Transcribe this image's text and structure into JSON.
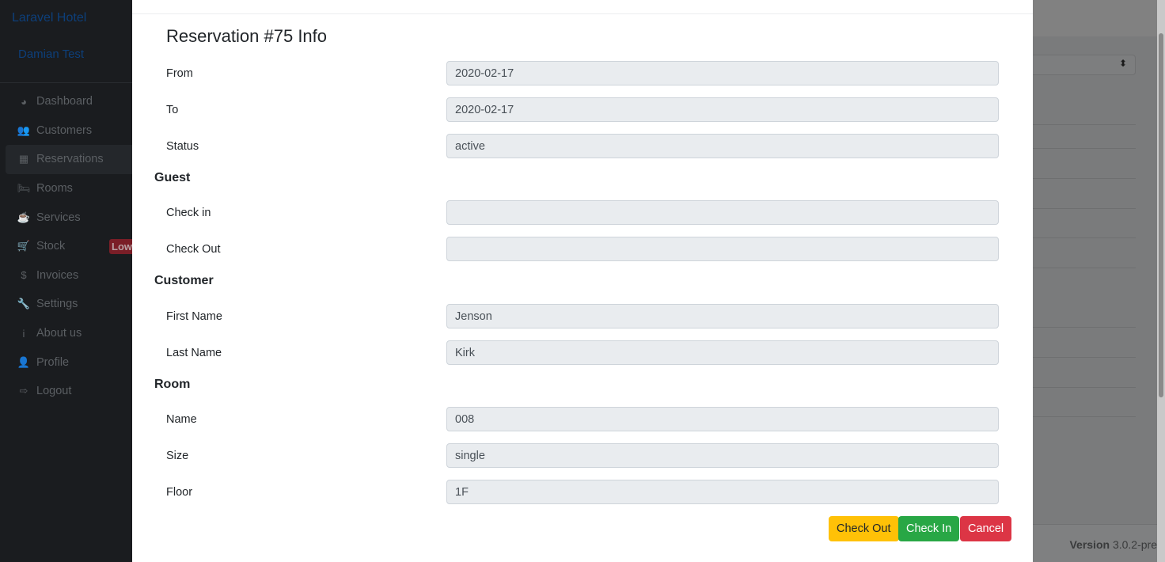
{
  "sidebar": {
    "brand": "Laravel Hotel",
    "user": "Damian Test",
    "items": [
      {
        "label": "Dashboard",
        "icon": "◕"
      },
      {
        "label": "Customers",
        "icon": "👥"
      },
      {
        "label": "Reservations",
        "icon": "▦"
      },
      {
        "label": "Rooms",
        "icon": "🛏"
      },
      {
        "label": "Services",
        "icon": "☕"
      },
      {
        "label": "Stock",
        "icon": "🛒",
        "badge": "Low"
      },
      {
        "label": "Invoices",
        "icon": "$"
      },
      {
        "label": "Settings",
        "icon": "🔧"
      },
      {
        "label": "About us",
        "icon": "i"
      },
      {
        "label": "Profile",
        "icon": "👤"
      },
      {
        "label": "Logout",
        "icon": "⇨"
      }
    ]
  },
  "footer": {
    "version_label": "Version",
    "version": "3.0.2-pre"
  },
  "modal": {
    "title": "Reservation #75 Info",
    "fields": [
      {
        "label": "From",
        "value": "2020-02-17"
      },
      {
        "label": "To",
        "value": "2020-02-17"
      },
      {
        "label": "Status",
        "value": "active"
      }
    ],
    "guest": {
      "heading": "Guest",
      "fields": [
        {
          "label": "Check in",
          "value": ""
        },
        {
          "label": "Check Out",
          "value": ""
        }
      ]
    },
    "customer": {
      "heading": "Customer",
      "fields": [
        {
          "label": "First Name",
          "value": "Jenson"
        },
        {
          "label": "Last Name",
          "value": "Kirk"
        }
      ]
    },
    "room": {
      "heading": "Room",
      "fields": [
        {
          "label": "Name",
          "value": "008"
        },
        {
          "label": "Size",
          "value": "single"
        },
        {
          "label": "Floor",
          "value": "1F"
        }
      ]
    },
    "buttons": {
      "check_out": "Check Out",
      "check_in": "Check In",
      "cancel": "Cancel"
    }
  },
  "colors": {
    "warning": "#ffc107",
    "success": "#28a745",
    "danger": "#dc3545"
  }
}
